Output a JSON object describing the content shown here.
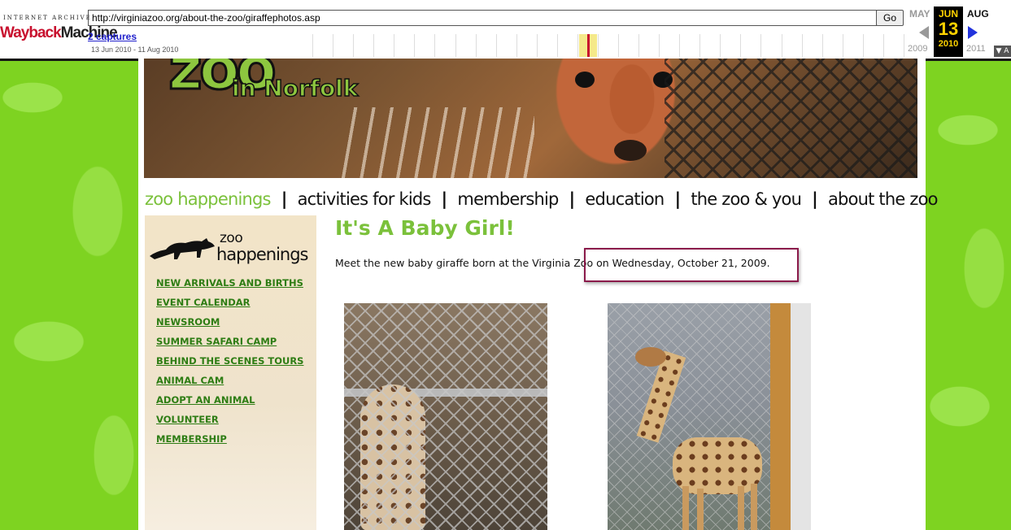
{
  "wayback": {
    "logo_top": "INTERNET ARCHIVE",
    "logo_main_a": "Wayback",
    "logo_main_b": "Machine",
    "url": "http://virginiazoo.org/about-the-zoo/giraffephotos.asp",
    "go_label": "Go",
    "captures": "2 captures",
    "range": "13 Jun 2010 - 11 Aug 2010",
    "prev_month": "MAY",
    "prev_year": "2009",
    "cur_month": "JUN",
    "cur_day": "13",
    "cur_year": "2010",
    "next_month": "AUG",
    "next_year": "2011",
    "about_label": "▼ A"
  },
  "banner": {
    "logo_zoo": "zoo",
    "logo_sub": "in Norfolk"
  },
  "nav": [
    {
      "label": "zoo happenings",
      "active": true
    },
    {
      "label": "activities for kids"
    },
    {
      "label": "membership"
    },
    {
      "label": "education"
    },
    {
      "label": "the zoo & you"
    },
    {
      "label": "about the zoo"
    }
  ],
  "nav_sep": "|",
  "sidebar": {
    "title_line1": "zoo",
    "title_line2": "happenings",
    "links": [
      "NEW ARRIVALS AND BIRTHS",
      "EVENT CALENDAR",
      "NEWSROOM",
      "SUMMER SAFARI CAMP",
      "BEHIND THE SCENES TOURS",
      "ANIMAL CAM",
      "ADOPT AN ANIMAL",
      "VOLUNTEER",
      "MEMBERSHIP"
    ]
  },
  "main": {
    "title": "It's A Baby Girl!",
    "intro": "Meet the new baby giraffe born at the Virginia Zoo on Wednesday, October 21, 2009."
  },
  "colors": {
    "accent_green": "#7bc13b",
    "link_green": "#2e7d14",
    "highlight_border": "#8a1a4a",
    "wayback_yellow": "#ffd200"
  }
}
